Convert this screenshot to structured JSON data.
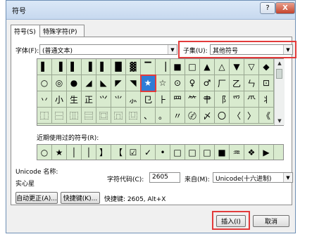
{
  "title": "符号",
  "help_btn": "?",
  "close_btn": "X",
  "tabs": [
    "符号(S)",
    "特殊字符(P)"
  ],
  "font_label": "字体(F):",
  "font_value": "(普通文本)",
  "subset_label": "子集(U):",
  "subset_value": "其他符号",
  "grid": [
    [
      "▌",
      "▐",
      "▌",
      "▐",
      "▌",
      "█",
      "▓",
      "▔",
      "▕",
      "■",
      "□",
      "▲",
      "△",
      "▼",
      "▽",
      "◆",
      "◇"
    ],
    [
      "○",
      "◎",
      "●",
      "◢",
      "◣",
      "◤",
      "◥",
      "★",
      "☆",
      "⊙",
      "♀",
      "♂",
      "厂",
      "乙",
      "ㄣ",
      "⊡"
    ],
    [
      "丷",
      "小",
      "生",
      "正",
      "⺍",
      "⺌",
      "⺗",
      "⺋",
      "⺊",
      "⺫",
      "⺮",
      "⺺",
      "⻏",
      "⺤",
      "⺥",
      "⺦"
    ],
    [
      "⿰",
      "⿱",
      "⿲",
      "⿳",
      "⿴",
      "⿵",
      "⿶",
      "、",
      "。",
      "〃",
      "〄",
      "〆",
      "〇",
      "〈",
      "〉",
      "《"
    ]
  ],
  "recent_label": "近期使用过的符号(R):",
  "recent": [
    "○",
    "★",
    "│",
    "│",
    "】",
    "【",
    "☑",
    "✓",
    "•",
    "□",
    "□",
    "□",
    "■",
    "♒",
    "❖",
    "▶"
  ],
  "unicode_name_label": "Unicode 名称:",
  "unicode_name_value": "实心星",
  "charcode_label": "字符代码(C):",
  "charcode_value": "2605",
  "from_label": "来自(M):",
  "from_value": "Unicode(十六进制)",
  "autocorrect_btn": "自动更正(A)...",
  "shortcut_btn": "快捷键(K)...",
  "shortcut_text": "快捷键: 2605, Alt+X",
  "insert_btn": "插入(I)",
  "cancel_btn": "取消"
}
